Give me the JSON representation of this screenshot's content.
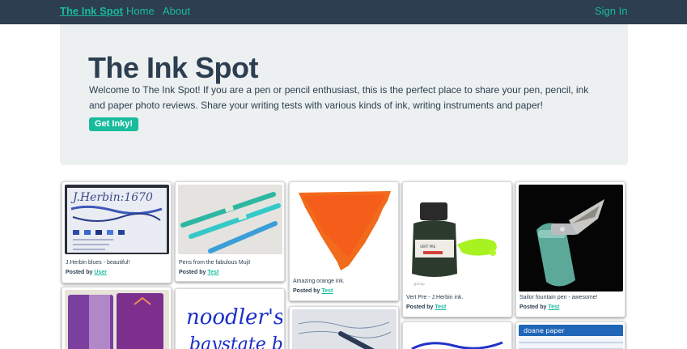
{
  "navbar": {
    "brand": "The Ink Spot",
    "links": [
      "Home",
      "About"
    ],
    "sign_in": "Sign In"
  },
  "jumbotron": {
    "title": "The Ink Spot",
    "text": "Welcome to The Ink Spot! If you are a pen or pencil enthusiast, this is the perfect place to share your pen, pencil, ink and paper photo reviews. Share your writing tests with various kinds of ink, writing instruments and paper!",
    "button": "Get Inky!"
  },
  "posted_by_label": "Posted by",
  "cards": [
    {
      "caption": "J.Herbin blues - beautiful!",
      "author": "User"
    },
    {
      "caption": "Pens from the fabulous Muji!",
      "author": "Test"
    },
    {
      "caption": "Amazing orange ink.",
      "author": "Test"
    },
    {
      "caption": "Vert Pre - J.Herbin ink.",
      "author": "Test"
    },
    {
      "caption": "Sailor fountain pen - awesome!",
      "author": "Test"
    }
  ],
  "image_text": {
    "jherbin": "J.Herbin:1670",
    "noodlers_1": "noodler's",
    "noodlers_2": "baystate blue",
    "vert_pre": "VERT PRE",
    "doane": "doane paper"
  },
  "colors": {
    "navbar": "#2c3e50",
    "accent": "#18bc9c",
    "jumbotron": "#ecf0f1",
    "text": "#2c3e50"
  }
}
